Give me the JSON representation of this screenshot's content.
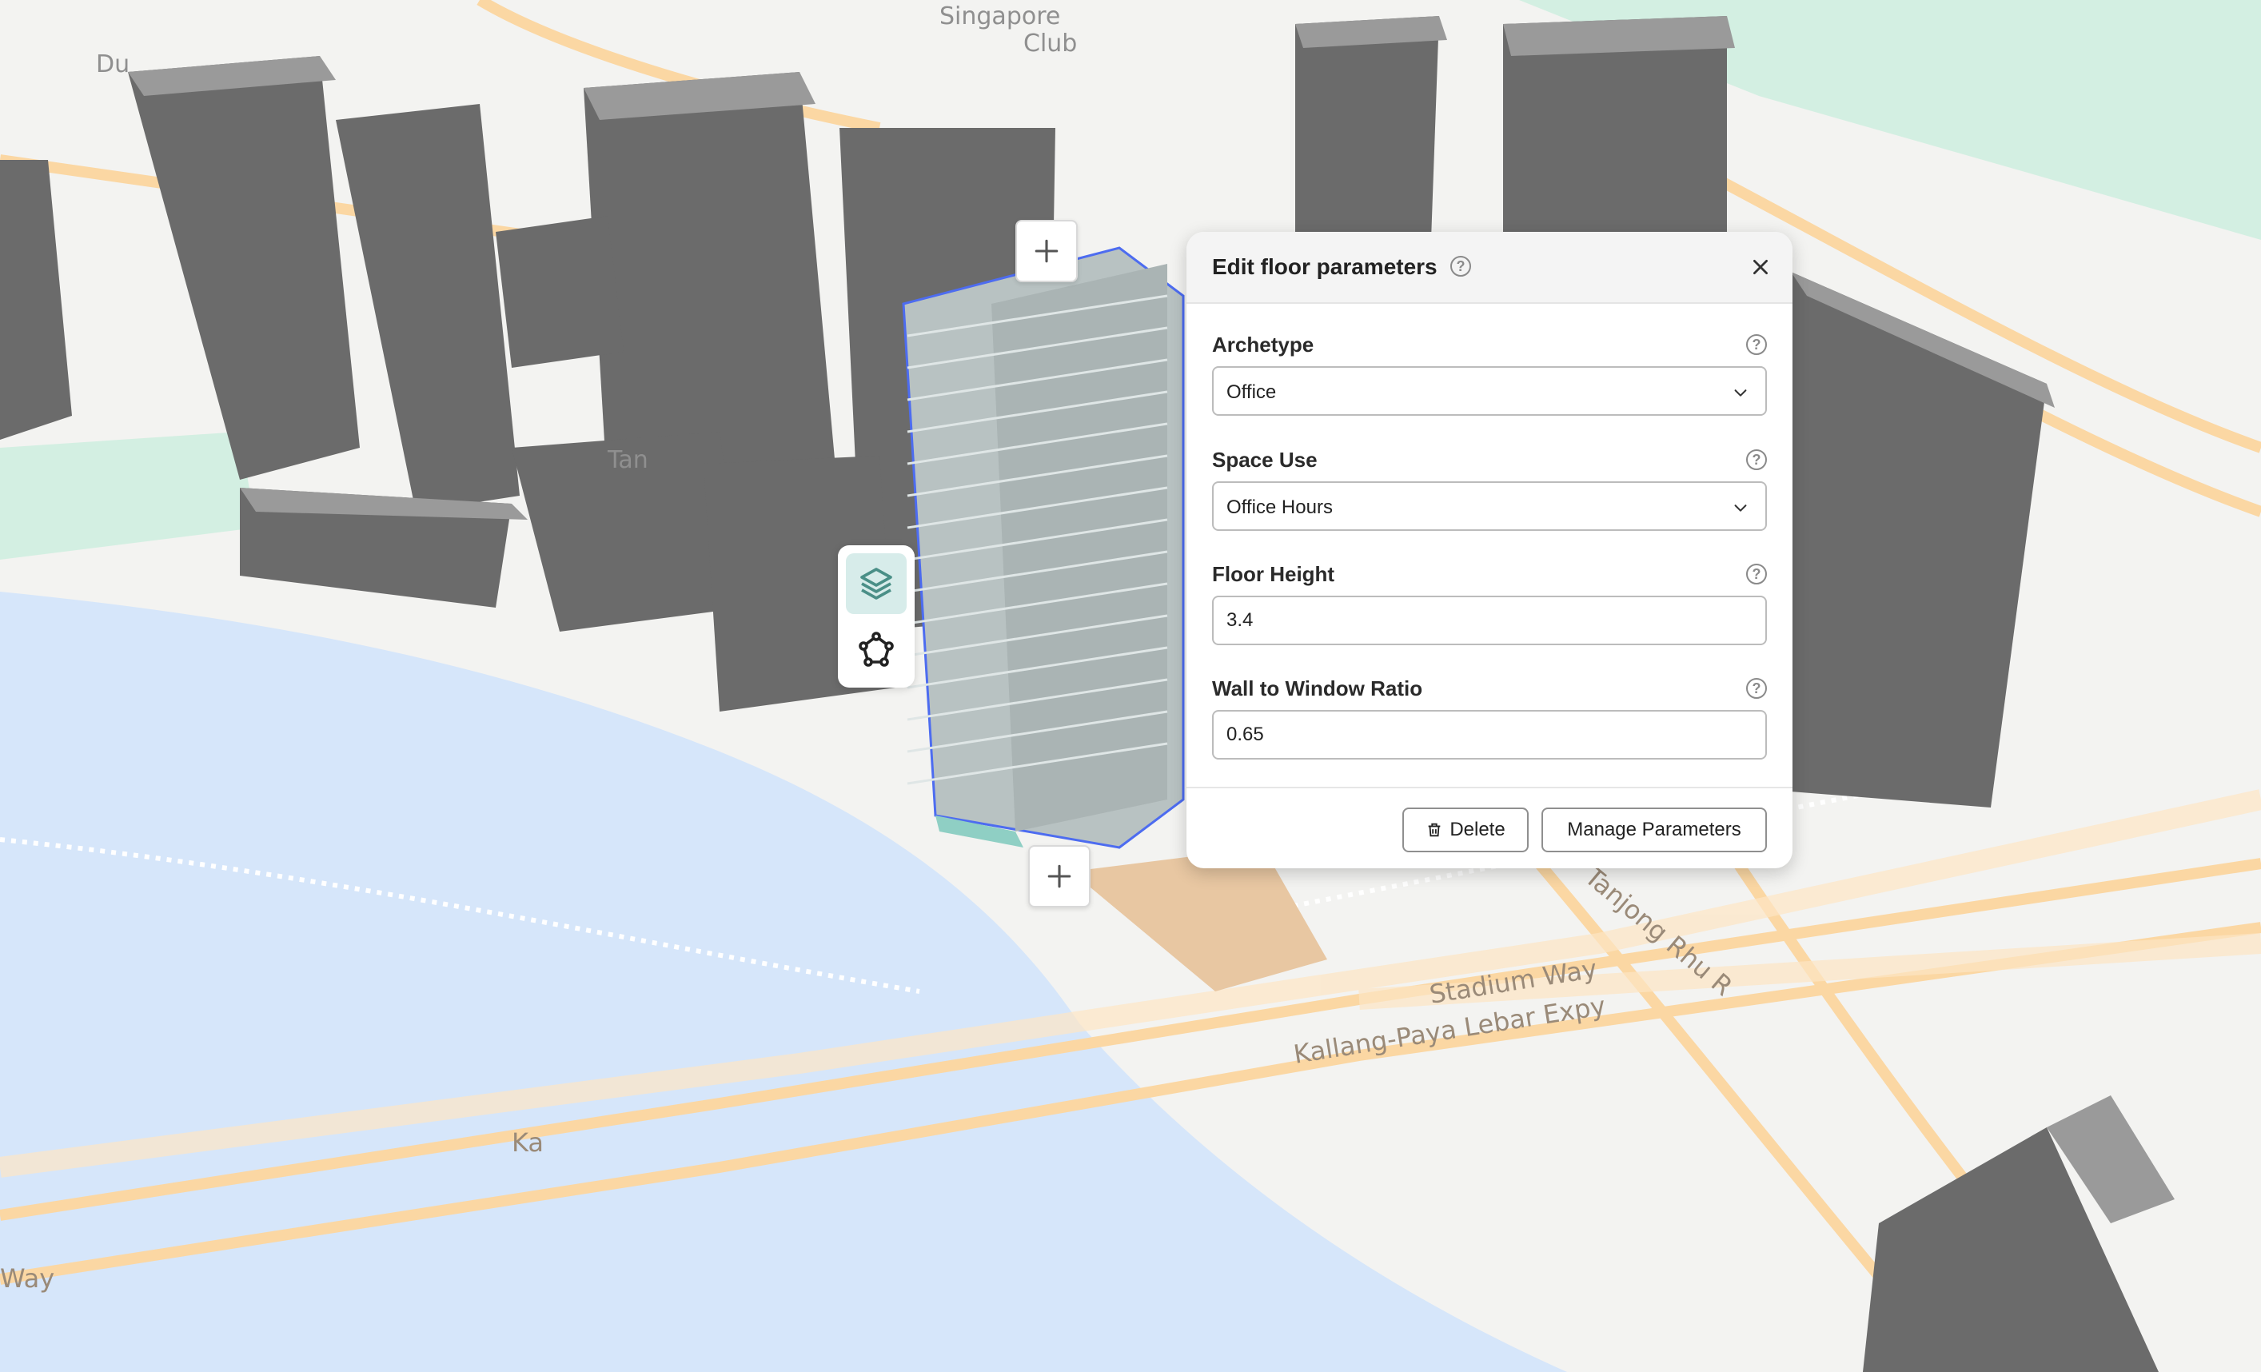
{
  "map": {
    "labels": {
      "singapore_club_1": "Singapore",
      "singapore_club_2": "Club",
      "du": "Du",
      "tan": "Tan",
      "stadium_way": "Stadium Way",
      "kpe": "Kallang-Paya Lebar Expy",
      "tanjong": "Tanjong Rhu R",
      "ka": "Ka",
      "way": "Way"
    },
    "colors": {
      "water": "#d6e6fa",
      "park": "#d3efe2",
      "road": "#fbd7a3",
      "building": "#6b6b6b",
      "building_light": "#9a9a9a",
      "selection": "#4d6cf0"
    }
  },
  "handles": {
    "top_icon": "plus-icon",
    "bottom_icon": "plus-icon"
  },
  "tools": [
    {
      "name": "layers-icon",
      "active": true
    },
    {
      "name": "polygon-edit-icon",
      "active": false
    }
  ],
  "panel": {
    "title": "Edit floor parameters",
    "close_icon": "close-icon",
    "fields": {
      "archetype": {
        "label": "Archetype",
        "value": "Office"
      },
      "space_use": {
        "label": "Space Use",
        "value": "Office Hours"
      },
      "floor_height": {
        "label": "Floor Height",
        "value": "3.4"
      },
      "wwr": {
        "label": "Wall to Window Ratio",
        "value": "0.65"
      }
    },
    "help_glyph": "?",
    "buttons": {
      "delete": "Delete",
      "manage": "Manage Parameters"
    }
  }
}
